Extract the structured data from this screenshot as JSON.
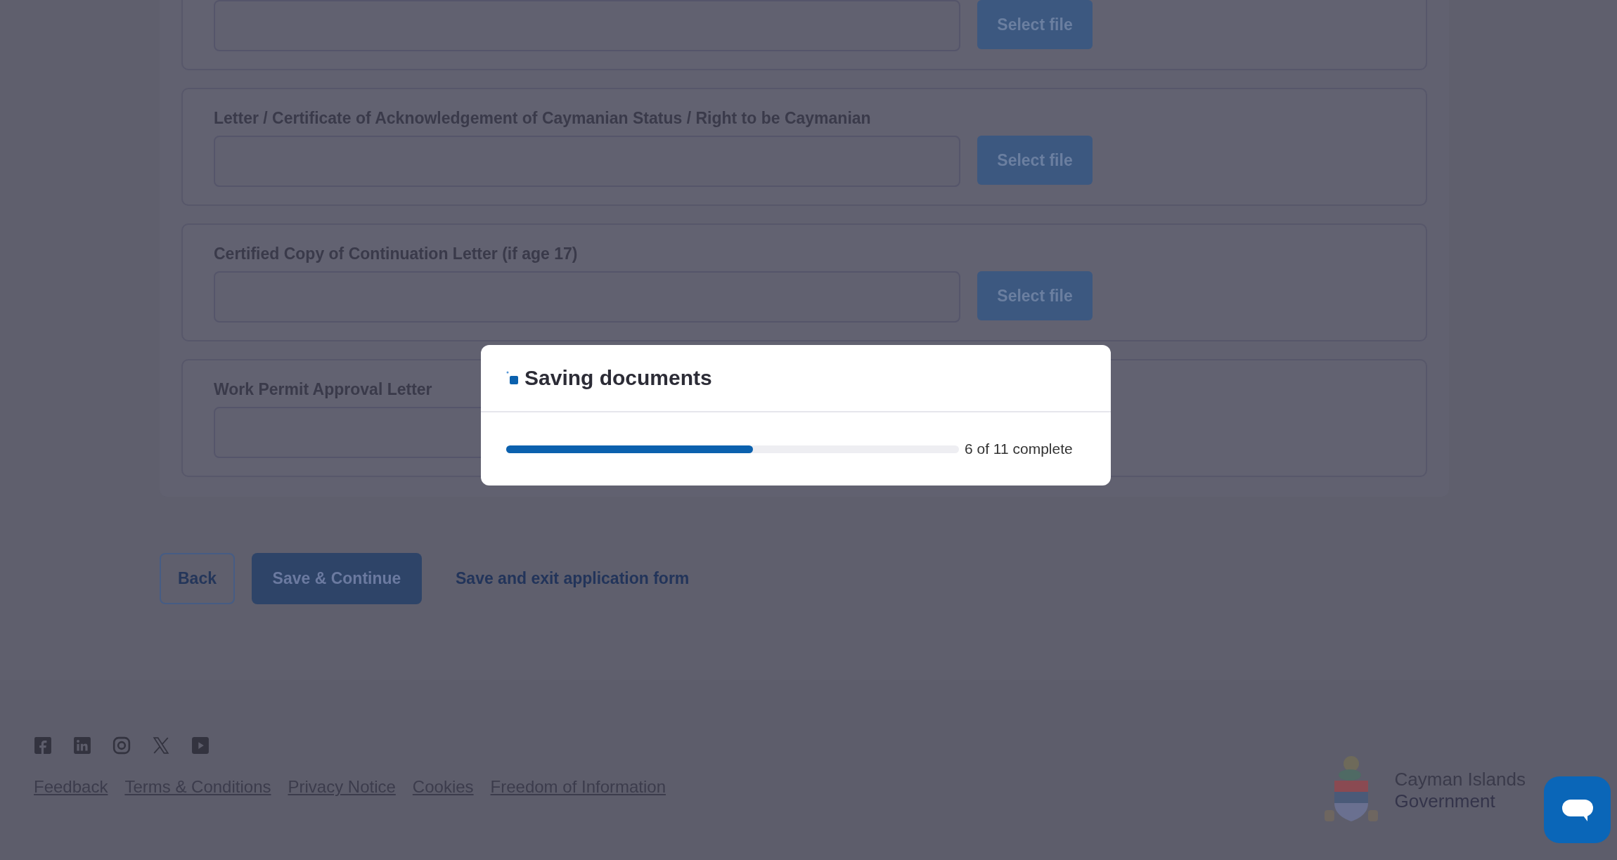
{
  "upload_cards": [
    {
      "button": "Select file"
    },
    {
      "label": "Letter / Certificate of Acknowledgement of Caymanian Status / Right to be Caymanian",
      "button": "Select file"
    },
    {
      "label": "Certified Copy of Continuation Letter (if age 17)",
      "button": "Select file"
    },
    {
      "label": "Work Permit Approval Letter"
    }
  ],
  "actions": {
    "back": "Back",
    "primary": "Save & Continue",
    "link": "Save and exit application form"
  },
  "modal": {
    "title": "Saving documents",
    "progress": {
      "level": 0.545,
      "reading": "6 of 11 complete"
    }
  },
  "footer": {
    "social": [
      {
        "kind": "facebook"
      },
      {
        "kind": "linkedin"
      },
      {
        "kind": "instagram"
      },
      {
        "kind": "x"
      },
      {
        "kind": "youtube"
      }
    ],
    "links": [
      "Feedback",
      "Terms & Conditions",
      "Privacy Notice",
      "Cookies",
      "Freedom of Information"
    ],
    "brand": {
      "name": "Cayman Islands",
      "sub": "Government"
    }
  }
}
